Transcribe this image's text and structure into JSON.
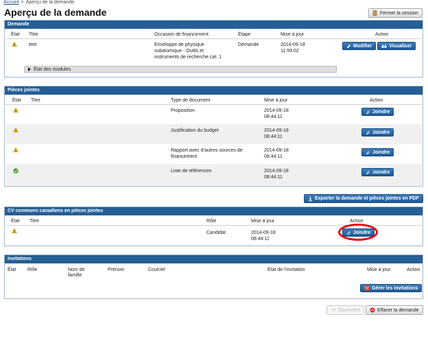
{
  "breadcrumb": {
    "home": "Accueil",
    "separator": ">",
    "current": "Aperçu de la demande"
  },
  "page_title": "Aperçu de la demande",
  "close_session_label": "Fermer la session",
  "demande": {
    "title": "Demande",
    "headers": {
      "etat": "État",
      "titre": "Titre",
      "occasion": "Occasion de financement",
      "etape": "Étape",
      "maj": "Mise à jour",
      "action": "Action"
    },
    "row": {
      "titre": "titre",
      "occasion": [
        "Enveloppe de physique",
        "subatomique - Outils et",
        "instruments de recherche cat. 1"
      ],
      "etape": "Demande",
      "date": "2014-09-18",
      "time": "11:59:02",
      "modifier": "Modifier",
      "visualiser": "Visualiser"
    },
    "modules_label": "État des modules"
  },
  "pieces": {
    "title": "Pièces jointes",
    "headers": {
      "etat": "État",
      "titre": "Titre",
      "type": "Type de document",
      "maj": "Mise à jour",
      "action": "Action"
    },
    "rows": [
      {
        "status": "warning",
        "type": [
          "Proposition"
        ],
        "date": "2014-09-18",
        "time": "08:44:11",
        "action": "Joindre"
      },
      {
        "status": "warning",
        "type": [
          "Justification du budget"
        ],
        "date": "2014-09-18",
        "time": "08:44:11",
        "action": "Joindre"
      },
      {
        "status": "warning",
        "type": [
          "Rapport avec d’autres sources de",
          "financement"
        ],
        "date": "2014-09-18",
        "time": "08:44:11",
        "action": "Joindre"
      },
      {
        "status": "ok",
        "type": [
          "Liste de références"
        ],
        "date": "2014-09-18",
        "time": "08:44:11",
        "action": "Joindre"
      }
    ]
  },
  "export_label": "Exporter la demande et pièces jointes en PDF",
  "cv": {
    "title": "CV communs canadiens en pièces jointes",
    "headers": {
      "etat": "État",
      "titre": "Titre",
      "role": "Rôle",
      "maj": "Mise à jour",
      "action": "Action"
    },
    "row": {
      "status": "warning",
      "role": "Candidat",
      "date": "2014-09-18",
      "time": "08:44:11",
      "action": "Joindre"
    }
  },
  "invitations": {
    "title": "Invitations",
    "headers": {
      "etat": "État",
      "role": "Rôle",
      "nom": [
        "Nom de",
        "famille"
      ],
      "prenom": "Prénom",
      "courriel": "Courriel",
      "etat_invitation": "État de l'invitation",
      "maj": "Mise à jour",
      "action": "Action"
    },
    "manage_label": "Gérer les invitations"
  },
  "footer": {
    "submit_label": "Soumettre",
    "delete_label": "Effacer la demande"
  },
  "colors": {
    "header_blue": "#255f96",
    "button_blue": "#2a6aa8",
    "highlight_red": "#e3000f",
    "warning_yellow": "#f1c40f",
    "ok_green": "#3a9d23"
  }
}
